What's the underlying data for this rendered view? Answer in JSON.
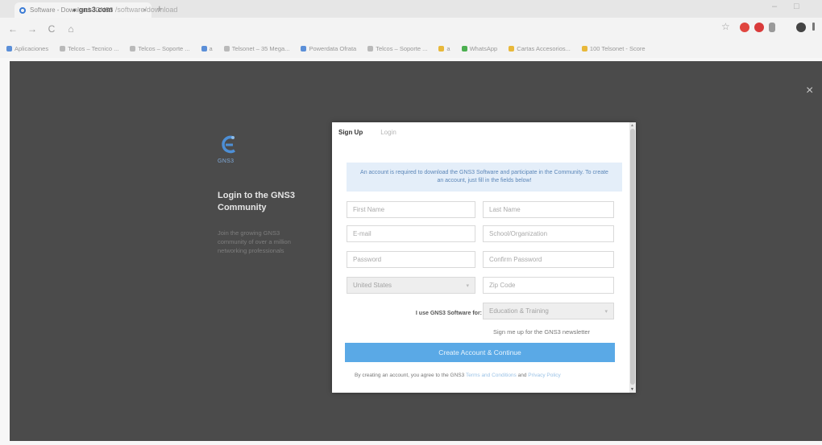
{
  "browser": {
    "tab_title": "Software - Download - GNS3",
    "tab_close": "×",
    "new_tab": "+",
    "nav": {
      "back": "←",
      "forward": "→",
      "reload": "C",
      "home": "⌂"
    },
    "url_domain": "gns3.com",
    "url_path": "/software/download",
    "lock": "🔒",
    "star": "☆",
    "window_controls": {
      "minimize": "–",
      "maximize": "□"
    }
  },
  "bookmarks": [
    {
      "label": "Aplicaciones",
      "icon": "apps-grid-icon"
    },
    {
      "label": "Telcos – Tecnico ...",
      "icon": "bookmark-icon"
    },
    {
      "label": "Telcos – Soporte ...",
      "icon": "bookmark-icon"
    },
    {
      "label": "a",
      "icon": "bookmark-icon"
    },
    {
      "label": "Telsonet – 35 Mega...",
      "icon": "bookmark-icon"
    },
    {
      "label": "Powerdata Ofrata",
      "icon": "bookmark-icon"
    },
    {
      "label": "Telcos – Soporte ...",
      "icon": "bookmark-icon"
    },
    {
      "label": "a",
      "icon": "bookmark-icon"
    },
    {
      "label": "WhatsApp",
      "icon": "whatsapp-icon"
    },
    {
      "label": "Cartas Accesorios...",
      "icon": "folder-icon"
    },
    {
      "label": "100 Telsonet - Score",
      "icon": "folder-icon"
    }
  ],
  "page": {
    "close": "×",
    "logo_text": "GNS3",
    "login_heading": "Login to the GNS3 Community",
    "login_sub": "Join the growing GNS3 community of over a million networking professionals"
  },
  "modal": {
    "tabs": {
      "signup": "Sign Up",
      "login": "Login"
    },
    "info": "An account is required to download the GNS3 Software and participate in the Community. To create an account, just fill in the fields below!",
    "fields": {
      "first_name": "First Name",
      "last_name": "Last Name",
      "email": "E-mail",
      "school": "School/Organization",
      "password": "Password",
      "confirm_password": "Confirm Password",
      "country": "United States",
      "zip": "Zip Code",
      "use_label": "I use GNS3 Software for:",
      "use_value": "Education & Training"
    },
    "newsletter": "Sign me up for the GNS3 newsletter",
    "create_button": "Create Account & Continue",
    "terms_prefix": "By creating an account, you agree to the GNS3",
    "terms_link": "Terms and Conditions",
    "terms_and": "and",
    "privacy_link": "Privacy Policy"
  },
  "colors": {
    "overlay": "#4b4b4b",
    "button": "#5aa9e6",
    "info_bg": "#e4eef9"
  }
}
